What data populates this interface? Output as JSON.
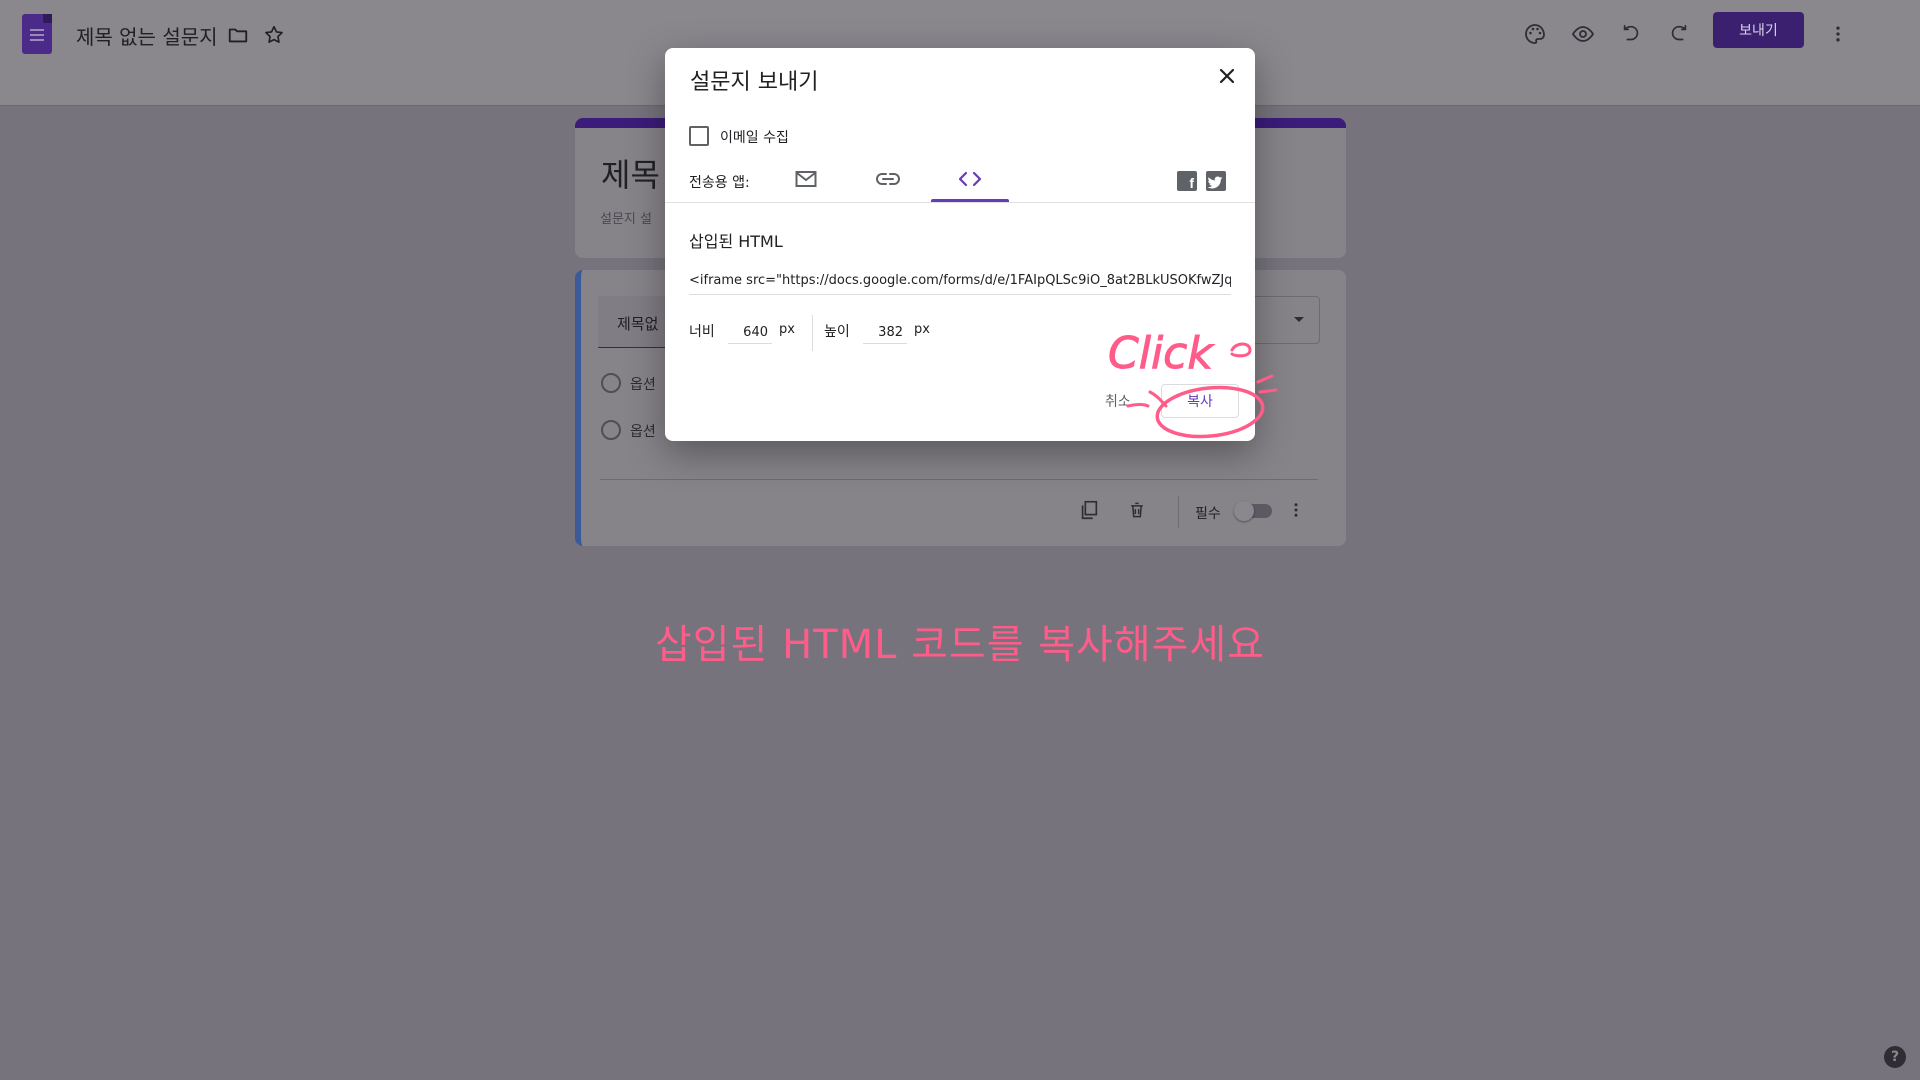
{
  "header": {
    "doc_title": "제목 없는 설문지",
    "send_label": "보내기"
  },
  "form": {
    "title": "제목",
    "description": "설문지 설",
    "question": "제목없",
    "options": [
      "옵션",
      "옵션"
    ],
    "required_label": "필수"
  },
  "dialog": {
    "title": "설문지 보내기",
    "collect_email_label": "이메일 수집",
    "send_via_label": "전송용 앱:",
    "section_title": "삽입된 HTML",
    "embed_code": "<iframe src=\"https://docs.google.com/forms/d/e/1FAIpQLSc9iO_8at2BLkUSOKfwZJq",
    "width_label": "너비",
    "width_value": "640",
    "height_label": "높이",
    "height_value": "382",
    "unit_label": "px",
    "cancel_label": "취소",
    "copy_label": "복사",
    "active_tab": "embed"
  },
  "annotation": {
    "handwritten_text": "Click",
    "caption": "삽입된 HTML 코드를 복사해주세요",
    "color": "#ff5c8a"
  },
  "colors": {
    "accent": "#673ab7",
    "overlay": "#76737c"
  },
  "help_label": "?"
}
